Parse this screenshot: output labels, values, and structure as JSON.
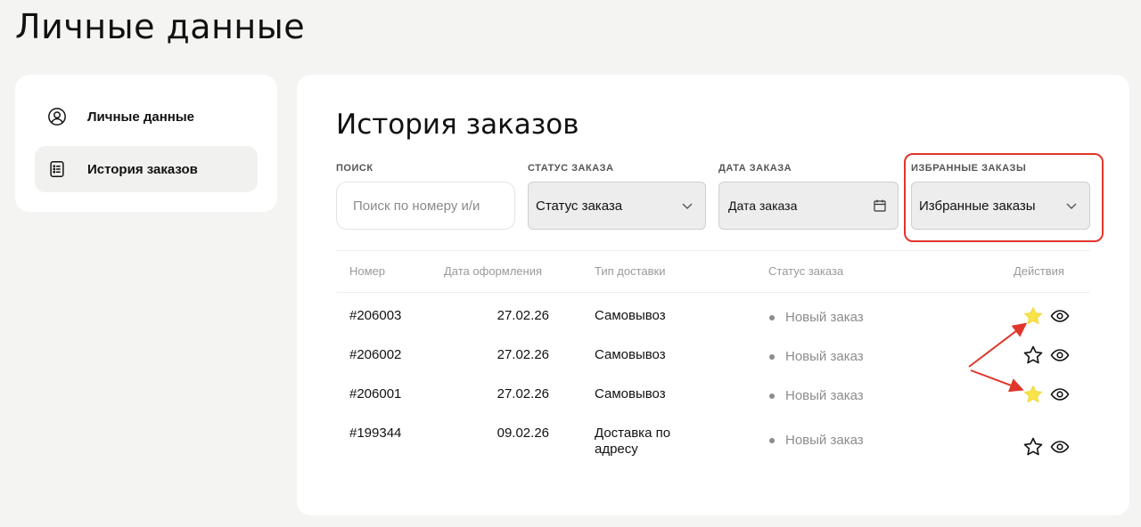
{
  "page": {
    "title": "Личные данные"
  },
  "sidebar": {
    "items": [
      {
        "label": "Личные данные",
        "icon": "user-circle-icon",
        "active": false
      },
      {
        "label": "История заказов",
        "icon": "receipt-list-icon",
        "active": true
      }
    ]
  },
  "main": {
    "title": "История заказов",
    "filters": {
      "search": {
        "label": "ПОИСК",
        "placeholder": "Поиск по номеру и/и"
      },
      "status": {
        "label": "СТАТУС ЗАКАЗА",
        "value": "Статус заказа"
      },
      "date": {
        "label": "ДАТА ЗАКАЗА",
        "value": "Дата заказа"
      },
      "favorites": {
        "label": "ИЗБРАННЫЕ ЗАКАЗЫ",
        "value": "Избранные заказы",
        "highlighted": true
      }
    },
    "table": {
      "columns": [
        "Номер",
        "Дата оформления",
        "Тип доставки",
        "Статус заказа",
        "Действия"
      ],
      "rows": [
        {
          "number": "#206003",
          "date": "27.02.26",
          "delivery": "Самовывоз",
          "status": "Новый заказ",
          "favorite": true
        },
        {
          "number": "#206002",
          "date": "27.02.26",
          "delivery": "Самовывоз",
          "status": "Новый заказ",
          "favorite": false
        },
        {
          "number": "#206001",
          "date": "27.02.26",
          "delivery": "Самовывоз",
          "status": "Новый заказ",
          "favorite": true
        },
        {
          "number": "#199344",
          "date": "09.02.26",
          "delivery": "Доставка по адресу",
          "status": "Новый заказ",
          "favorite": false
        }
      ]
    }
  },
  "colors": {
    "background": "#f4f4f2",
    "card": "#ffffff",
    "highlight": "#e0362b",
    "star_filled": "#f7e34a",
    "status_dot": "#8c8c8c"
  }
}
